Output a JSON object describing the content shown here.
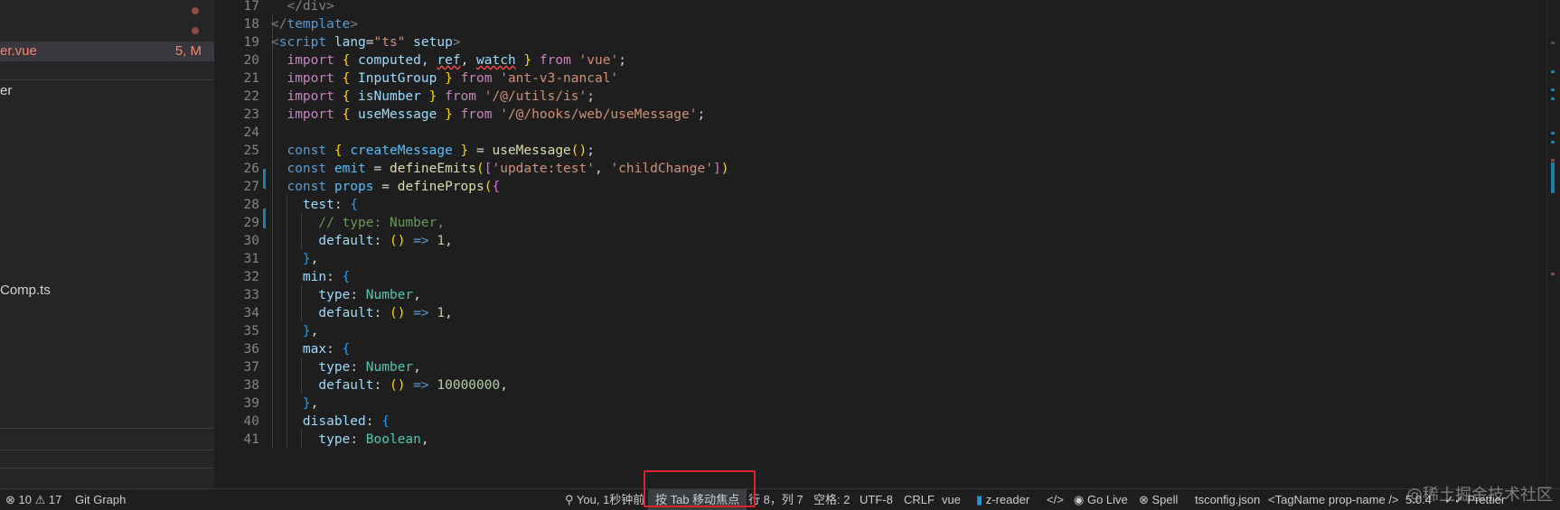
{
  "sidebar": {
    "files": [
      {
        "name": "er.vue",
        "status": "5, M",
        "active": true,
        "color": "#f48771"
      },
      {
        "name": "er",
        "status": "",
        "active": false,
        "color": "#cccccc"
      },
      {
        "name": "Comp.ts",
        "status": "",
        "active": false,
        "color": "#cccccc"
      }
    ]
  },
  "editor": {
    "line_numbers": [
      "17",
      "18",
      "19",
      "20",
      "21",
      "22",
      "23",
      "24",
      "25",
      "26",
      "27",
      "28",
      "29",
      "30",
      "31",
      "32",
      "33",
      "34",
      "35",
      "36",
      "37",
      "38",
      "39",
      "40",
      "41"
    ],
    "lines": [
      [
        {
          "t": "  </div>",
          "c": "#808080"
        }
      ],
      [
        {
          "t": "</",
          "c": "#808080"
        },
        {
          "t": "template",
          "c": "#569cd6"
        },
        {
          "t": ">",
          "c": "#808080"
        }
      ],
      [
        {
          "t": "<",
          "c": "#808080"
        },
        {
          "t": "script",
          "c": "#569cd6"
        },
        {
          "t": " ",
          "c": "#d4d4d4"
        },
        {
          "t": "lang",
          "c": "#9cdcfe"
        },
        {
          "t": "=",
          "c": "#d4d4d4"
        },
        {
          "t": "\"ts\"",
          "c": "#ce9178"
        },
        {
          "t": " ",
          "c": "#d4d4d4"
        },
        {
          "t": "setup",
          "c": "#9cdcfe"
        },
        {
          "t": ">",
          "c": "#808080"
        }
      ],
      [
        {
          "t": "  ",
          "c": "#d4d4d4"
        },
        {
          "t": "import",
          "c": "#c586c0"
        },
        {
          "t": " ",
          "c": "#d4d4d4"
        },
        {
          "t": "{",
          "c": "#ffd700"
        },
        {
          "t": " computed, ",
          "c": "#9cdcfe"
        },
        {
          "t": "ref",
          "c": "#9cdcfe"
        },
        {
          "t": ", ",
          "c": "#d4d4d4"
        },
        {
          "t": "watch",
          "c": "#9cdcfe"
        },
        {
          "t": " ",
          "c": "#d4d4d4"
        },
        {
          "t": "}",
          "c": "#ffd700"
        },
        {
          "t": " ",
          "c": "#d4d4d4"
        },
        {
          "t": "from",
          "c": "#c586c0"
        },
        {
          "t": " ",
          "c": "#d4d4d4"
        },
        {
          "t": "'vue'",
          "c": "#ce9178"
        },
        {
          "t": ";",
          "c": "#d4d4d4"
        }
      ],
      [
        {
          "t": "  ",
          "c": "#d4d4d4"
        },
        {
          "t": "import",
          "c": "#c586c0"
        },
        {
          "t": " ",
          "c": "#d4d4d4"
        },
        {
          "t": "{",
          "c": "#ffd700"
        },
        {
          "t": " InputGroup ",
          "c": "#9cdcfe"
        },
        {
          "t": "}",
          "c": "#ffd700"
        },
        {
          "t": " ",
          "c": "#d4d4d4"
        },
        {
          "t": "from",
          "c": "#c586c0"
        },
        {
          "t": " ",
          "c": "#d4d4d4"
        },
        {
          "t": "'ant-v3-nancal'",
          "c": "#ce9178"
        }
      ],
      [
        {
          "t": "  ",
          "c": "#d4d4d4"
        },
        {
          "t": "import",
          "c": "#c586c0"
        },
        {
          "t": " ",
          "c": "#d4d4d4"
        },
        {
          "t": "{",
          "c": "#ffd700"
        },
        {
          "t": " isNumber ",
          "c": "#9cdcfe"
        },
        {
          "t": "}",
          "c": "#ffd700"
        },
        {
          "t": " ",
          "c": "#d4d4d4"
        },
        {
          "t": "from",
          "c": "#c586c0"
        },
        {
          "t": " ",
          "c": "#d4d4d4"
        },
        {
          "t": "'/@/utils/is'",
          "c": "#ce9178"
        },
        {
          "t": ";",
          "c": "#d4d4d4"
        }
      ],
      [
        {
          "t": "  ",
          "c": "#d4d4d4"
        },
        {
          "t": "import",
          "c": "#c586c0"
        },
        {
          "t": " ",
          "c": "#d4d4d4"
        },
        {
          "t": "{",
          "c": "#ffd700"
        },
        {
          "t": " useMessage ",
          "c": "#9cdcfe"
        },
        {
          "t": "}",
          "c": "#ffd700"
        },
        {
          "t": " ",
          "c": "#d4d4d4"
        },
        {
          "t": "from",
          "c": "#c586c0"
        },
        {
          "t": " ",
          "c": "#d4d4d4"
        },
        {
          "t": "'/@/hooks/web/useMessage'",
          "c": "#ce9178"
        },
        {
          "t": ";",
          "c": "#d4d4d4"
        }
      ],
      [
        {
          "t": "",
          "c": "#d4d4d4"
        }
      ],
      [
        {
          "t": "  ",
          "c": "#d4d4d4"
        },
        {
          "t": "const",
          "c": "#569cd6"
        },
        {
          "t": " ",
          "c": "#d4d4d4"
        },
        {
          "t": "{",
          "c": "#ffd700"
        },
        {
          "t": " createMessage ",
          "c": "#4fc1ff"
        },
        {
          "t": "}",
          "c": "#ffd700"
        },
        {
          "t": " = ",
          "c": "#d4d4d4"
        },
        {
          "t": "useMessage",
          "c": "#dcdcaa"
        },
        {
          "t": "()",
          "c": "#ffd700"
        },
        {
          "t": ";",
          "c": "#d4d4d4"
        }
      ],
      [
        {
          "t": "  ",
          "c": "#d4d4d4"
        },
        {
          "t": "const",
          "c": "#569cd6"
        },
        {
          "t": " ",
          "c": "#d4d4d4"
        },
        {
          "t": "emit",
          "c": "#4fc1ff"
        },
        {
          "t": " = ",
          "c": "#d4d4d4"
        },
        {
          "t": "defineEmits",
          "c": "#dcdcaa"
        },
        {
          "t": "(",
          "c": "#ffd700"
        },
        {
          "t": "[",
          "c": "#da70d6"
        },
        {
          "t": "'update:test'",
          "c": "#ce9178"
        },
        {
          "t": ", ",
          "c": "#d4d4d4"
        },
        {
          "t": "'childChange'",
          "c": "#ce9178"
        },
        {
          "t": "]",
          "c": "#da70d6"
        },
        {
          "t": ")",
          "c": "#ffd700"
        }
      ],
      [
        {
          "t": "  ",
          "c": "#d4d4d4"
        },
        {
          "t": "const",
          "c": "#569cd6"
        },
        {
          "t": " ",
          "c": "#d4d4d4"
        },
        {
          "t": "props",
          "c": "#4fc1ff"
        },
        {
          "t": " = ",
          "c": "#d4d4d4"
        },
        {
          "t": "defineProps",
          "c": "#dcdcaa"
        },
        {
          "t": "(",
          "c": "#ffd700"
        },
        {
          "t": "{",
          "c": "#da70d6"
        }
      ],
      [
        {
          "t": "    ",
          "c": "#d4d4d4"
        },
        {
          "t": "test",
          "c": "#9cdcfe"
        },
        {
          "t": ": ",
          "c": "#d4d4d4"
        },
        {
          "t": "{",
          "c": "#179fff"
        }
      ],
      [
        {
          "t": "      ",
          "c": "#d4d4d4"
        },
        {
          "t": "// type: Number,",
          "c": "#6a9955"
        }
      ],
      [
        {
          "t": "      ",
          "c": "#d4d4d4"
        },
        {
          "t": "default",
          "c": "#9cdcfe"
        },
        {
          "t": ": ",
          "c": "#d4d4d4"
        },
        {
          "t": "()",
          "c": "#ffd700"
        },
        {
          "t": " ",
          "c": "#d4d4d4"
        },
        {
          "t": "=>",
          "c": "#569cd6"
        },
        {
          "t": " ",
          "c": "#d4d4d4"
        },
        {
          "t": "1",
          "c": "#b5cea8"
        },
        {
          "t": ",",
          "c": "#d4d4d4"
        }
      ],
      [
        {
          "t": "    ",
          "c": "#d4d4d4"
        },
        {
          "t": "}",
          "c": "#179fff"
        },
        {
          "t": ",",
          "c": "#d4d4d4"
        }
      ],
      [
        {
          "t": "    ",
          "c": "#d4d4d4"
        },
        {
          "t": "min",
          "c": "#9cdcfe"
        },
        {
          "t": ": ",
          "c": "#d4d4d4"
        },
        {
          "t": "{",
          "c": "#179fff"
        }
      ],
      [
        {
          "t": "      ",
          "c": "#d4d4d4"
        },
        {
          "t": "type",
          "c": "#9cdcfe"
        },
        {
          "t": ": ",
          "c": "#d4d4d4"
        },
        {
          "t": "Number",
          "c": "#4ec9b0"
        },
        {
          "t": ",",
          "c": "#d4d4d4"
        }
      ],
      [
        {
          "t": "      ",
          "c": "#d4d4d4"
        },
        {
          "t": "default",
          "c": "#9cdcfe"
        },
        {
          "t": ": ",
          "c": "#d4d4d4"
        },
        {
          "t": "()",
          "c": "#ffd700"
        },
        {
          "t": " ",
          "c": "#d4d4d4"
        },
        {
          "t": "=>",
          "c": "#569cd6"
        },
        {
          "t": " ",
          "c": "#d4d4d4"
        },
        {
          "t": "1",
          "c": "#b5cea8"
        },
        {
          "t": ",",
          "c": "#d4d4d4"
        }
      ],
      [
        {
          "t": "    ",
          "c": "#d4d4d4"
        },
        {
          "t": "}",
          "c": "#179fff"
        },
        {
          "t": ",",
          "c": "#d4d4d4"
        }
      ],
      [
        {
          "t": "    ",
          "c": "#d4d4d4"
        },
        {
          "t": "max",
          "c": "#9cdcfe"
        },
        {
          "t": ": ",
          "c": "#d4d4d4"
        },
        {
          "t": "{",
          "c": "#179fff"
        }
      ],
      [
        {
          "t": "      ",
          "c": "#d4d4d4"
        },
        {
          "t": "type",
          "c": "#9cdcfe"
        },
        {
          "t": ": ",
          "c": "#d4d4d4"
        },
        {
          "t": "Number",
          "c": "#4ec9b0"
        },
        {
          "t": ",",
          "c": "#d4d4d4"
        }
      ],
      [
        {
          "t": "      ",
          "c": "#d4d4d4"
        },
        {
          "t": "default",
          "c": "#9cdcfe"
        },
        {
          "t": ": ",
          "c": "#d4d4d4"
        },
        {
          "t": "()",
          "c": "#ffd700"
        },
        {
          "t": " ",
          "c": "#d4d4d4"
        },
        {
          "t": "=>",
          "c": "#569cd6"
        },
        {
          "t": " ",
          "c": "#d4d4d4"
        },
        {
          "t": "10000000",
          "c": "#b5cea8"
        },
        {
          "t": ",",
          "c": "#d4d4d4"
        }
      ],
      [
        {
          "t": "    ",
          "c": "#d4d4d4"
        },
        {
          "t": "}",
          "c": "#179fff"
        },
        {
          "t": ",",
          "c": "#d4d4d4"
        }
      ],
      [
        {
          "t": "    ",
          "c": "#d4d4d4"
        },
        {
          "t": "disabled",
          "c": "#9cdcfe"
        },
        {
          "t": ": ",
          "c": "#d4d4d4"
        },
        {
          "t": "{",
          "c": "#179fff"
        }
      ],
      [
        {
          "t": "      ",
          "c": "#d4d4d4"
        },
        {
          "t": "type",
          "c": "#9cdcfe"
        },
        {
          "t": ": ",
          "c": "#d4d4d4"
        },
        {
          "t": "Boolean",
          "c": "#4ec9b0"
        },
        {
          "t": ",",
          "c": "#d4d4d4"
        }
      ]
    ]
  },
  "statusbar": {
    "problems": "⊗ 10 ⚠ 17",
    "git_graph": "Git Graph",
    "blame": "You, 1秒钟前",
    "tab_hint": "按 Tab 移动焦点",
    "position": "行 8，列 7",
    "spaces": "空格: 2",
    "encoding": "UTF-8",
    "eol": "CRLF",
    "language": "vue",
    "zreader": "z-reader",
    "golive": "Go Live",
    "spell": "Spell",
    "tsconfig": "tsconfig.json",
    "tagname": "<TagName prop-name />",
    "version": "5.0.4",
    "prettier": "Prettier"
  },
  "watermark": "@稀土掘金技术社区"
}
